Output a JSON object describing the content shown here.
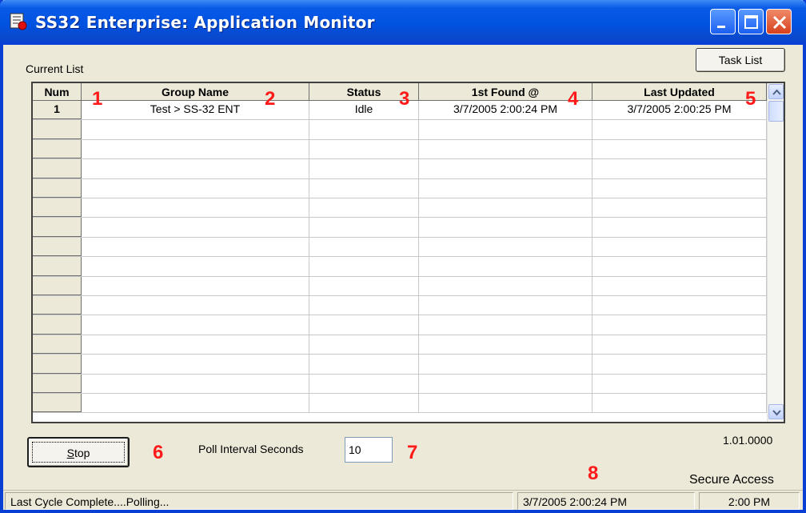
{
  "window": {
    "title": "SS32 Enterprise: Application Monitor"
  },
  "labels": {
    "current_list": "Current List",
    "task_list_button": "Task List",
    "poll_interval_label": "Poll Interval Seconds",
    "poll_interval_value": "10",
    "stop_button_prefix": "S",
    "stop_button_rest": "top",
    "version": "1.01.0000",
    "secure_access": "Secure Access"
  },
  "grid": {
    "columns": [
      "Num",
      "Group Name",
      "Status",
      "1st Found @",
      "Last Updated"
    ],
    "rows": [
      {
        "num": "1",
        "group_name": "Test  >  SS-32 ENT",
        "status": "Idle",
        "first_found": "3/7/2005 2:00:24 PM",
        "last_updated": "3/7/2005 2:00:25 PM"
      }
    ],
    "empty_row_count": 15
  },
  "callouts": [
    "1",
    "2",
    "3",
    "4",
    "5",
    "6",
    "7",
    "8"
  ],
  "statusbar": {
    "message": "Last Cycle Complete....Polling...",
    "timestamp": "3/7/2005 2:00:24 PM",
    "clock": "2:00 PM"
  },
  "colors": {
    "titlebar": "#0052e0",
    "callout": "#ff1a1a",
    "window_bg": "#ece9d8"
  }
}
